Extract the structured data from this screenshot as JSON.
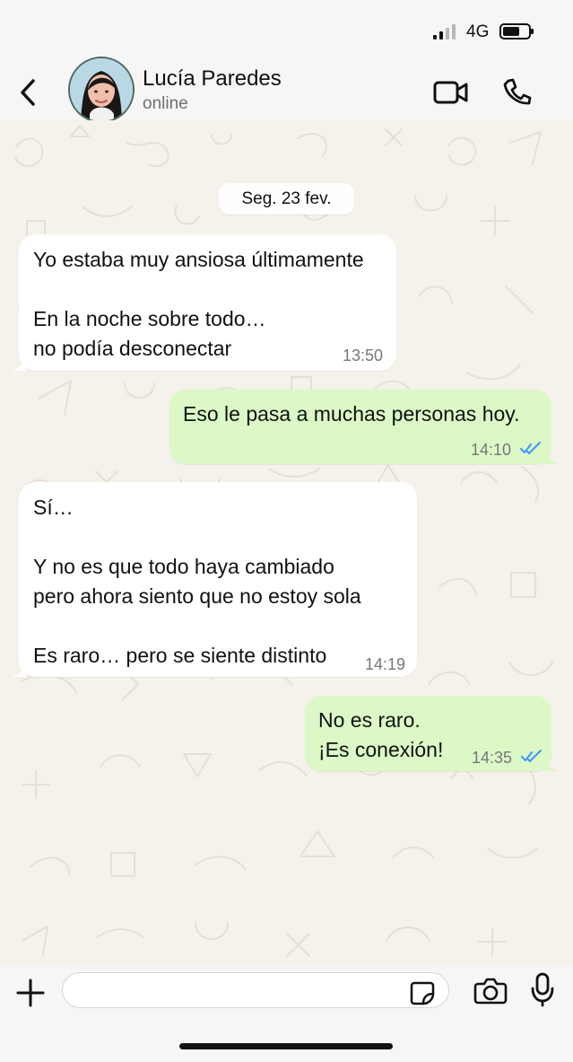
{
  "status_bar": {
    "network": "4G",
    "icons": [
      "signal-icon",
      "battery-icon"
    ]
  },
  "header": {
    "contact_name": "Lucía Paredes",
    "contact_status": "online",
    "icons": [
      "back-icon",
      "avatar",
      "video-call-icon",
      "phone-call-icon"
    ]
  },
  "chat": {
    "date_divider": "Seg. 23 fev.",
    "messages": [
      {
        "direction": "incoming",
        "lines": [
          "Yo estaba muy ansiosa últimamente",
          "",
          "En la noche sobre todo…",
          "no podía desconectar"
        ],
        "time": "13:50"
      },
      {
        "direction": "outgoing",
        "lines": [
          "Eso le pasa a muchas personas hoy."
        ],
        "time": "14:10",
        "read_receipt": "double-check-icon"
      },
      {
        "direction": "incoming",
        "lines": [
          "Sí…",
          "",
          "Y no es que todo haya cambiado",
          "pero ahora siento que no estoy sola",
          "",
          "Es raro… pero se siente distinto"
        ],
        "time": "14:19"
      },
      {
        "direction": "outgoing",
        "lines": [
          "No es raro.",
          "¡Es conexión!"
        ],
        "time": "14:35",
        "read_receipt": "double-check-icon"
      }
    ]
  },
  "composer": {
    "value": "",
    "placeholder": "",
    "icons": [
      "plus-icon",
      "sticker-icon",
      "camera-icon",
      "microphone-icon"
    ]
  },
  "colors": {
    "chat_background": "#f5f1eb",
    "incoming_bubble": "#ffffff",
    "outgoing_bubble": "#dcf8c6",
    "read_receipt": "#3d96ff",
    "top_and_bottom_bars": "#f6f6f6"
  }
}
